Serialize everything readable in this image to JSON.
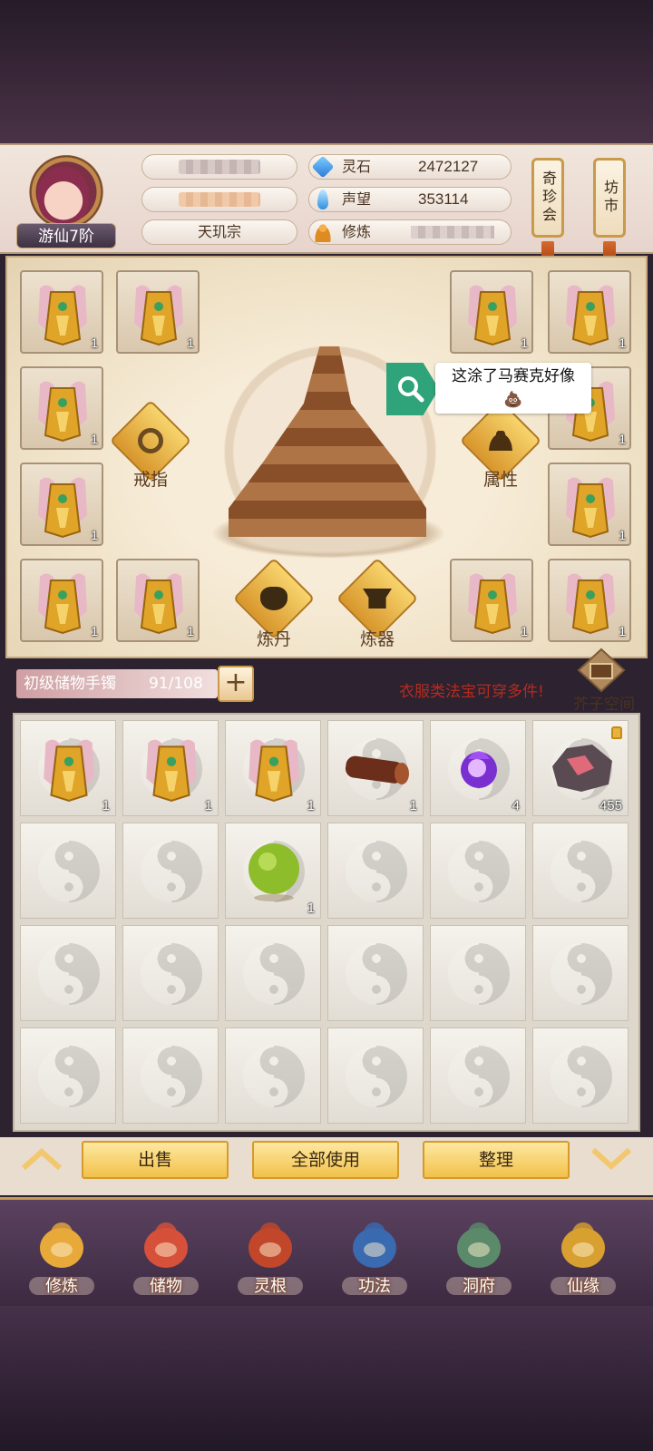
{
  "header": {
    "rank": "游仙7阶",
    "sect": "天玑宗",
    "resources": [
      {
        "label": "灵石",
        "value": "2472127",
        "icon": "spirit-stone-icon",
        "color": "#3a90e0"
      },
      {
        "label": "声望",
        "value": "353114",
        "icon": "reputation-icon",
        "color": "#4aa3e8"
      },
      {
        "label": "修炼",
        "value": "",
        "icon": "meditation-icon",
        "color": "#d98c2c"
      }
    ],
    "shops": [
      {
        "label": "奇珍会"
      },
      {
        "label": "坊市"
      }
    ]
  },
  "equipment": {
    "functions": {
      "ring": "戒指",
      "attributes": "属性",
      "alchemy": "炼丹",
      "forging": "炼器"
    },
    "slot_count": "1"
  },
  "tooltip": {
    "text": "这涂了马赛克好像💩"
  },
  "storage": {
    "name": "初级储物手镯",
    "count": "91/108",
    "plus": "+",
    "note": "衣服类法宝可穿多件!",
    "mustard_space": "芥子空间"
  },
  "inventory": {
    "items": [
      {
        "icon": "golden-armor-icon",
        "count": "1"
      },
      {
        "icon": "golden-armor-icon",
        "count": "1"
      },
      {
        "icon": "golden-armor-icon",
        "count": "1"
      },
      {
        "icon": "wood-log-icon",
        "count": "1"
      },
      {
        "icon": "purple-flame-orb-icon",
        "count": "4"
      },
      {
        "icon": "ore-stone-icon",
        "count": "455",
        "locked": true
      },
      {
        "icon": "green-jade-orb-icon",
        "count": "1"
      }
    ]
  },
  "actions": {
    "sell": "出售",
    "use_all": "全部使用",
    "sort": "整理"
  },
  "nav": [
    {
      "label": "修炼",
      "icon": "cultivate-icon"
    },
    {
      "label": "储物",
      "icon": "storage-bag-icon"
    },
    {
      "label": "灵根",
      "icon": "spirit-root-icon"
    },
    {
      "label": "功法",
      "icon": "technique-book-icon"
    },
    {
      "label": "洞府",
      "icon": "cave-dwelling-icon"
    },
    {
      "label": "仙缘",
      "icon": "immortal-fate-icon"
    }
  ]
}
